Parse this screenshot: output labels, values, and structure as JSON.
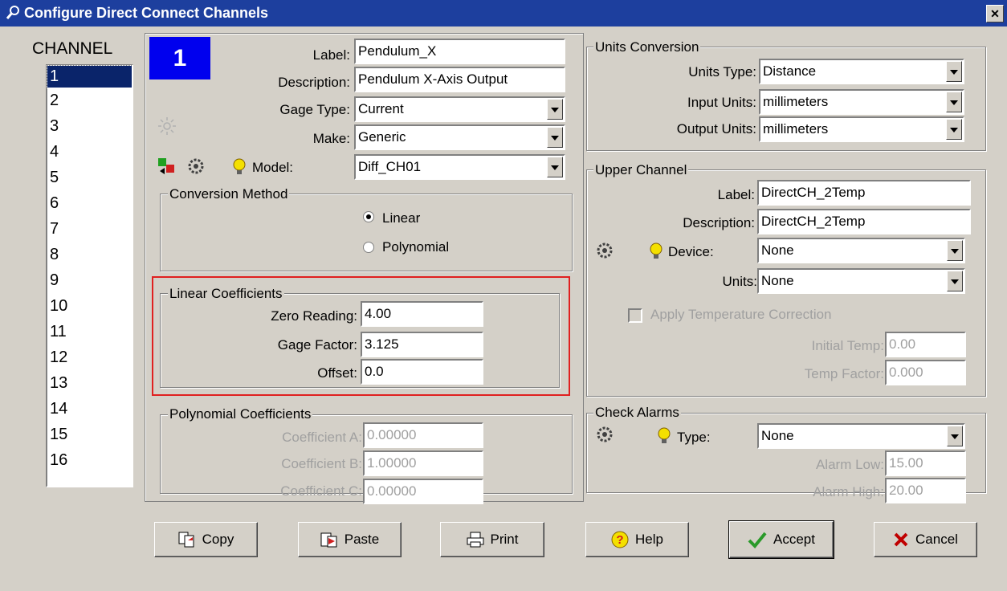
{
  "title": "Configure Direct Connect Channels",
  "channel_header": "CHANNEL",
  "channels": [
    "1",
    "2",
    "3",
    "4",
    "5",
    "6",
    "7",
    "8",
    "9",
    "10",
    "11",
    "12",
    "13",
    "14",
    "15",
    "16"
  ],
  "selected_channel": "1",
  "main": {
    "label_caption": "Label:",
    "label_value": "Pendulum_X",
    "description_caption": "Description:",
    "description_value": "Pendulum X-Axis Output",
    "gage_type_caption": "Gage Type:",
    "gage_type_value": "Current",
    "make_caption": "Make:",
    "make_value": "Generic",
    "model_caption": "Model:",
    "model_value": "Diff_CH01"
  },
  "conversion": {
    "title": "Conversion Method",
    "linear": "Linear",
    "polynomial": "Polynomial",
    "selected": "Linear"
  },
  "linear": {
    "title": "Linear Coefficients",
    "zero_caption": "Zero Reading:",
    "zero_value": "4.00",
    "gage_factor_caption": "Gage Factor:",
    "gage_factor_value": "3.125",
    "offset_caption": "Offset:",
    "offset_value": "0.0"
  },
  "polynomial": {
    "title": "Polynomial Coefficients",
    "a_caption": "Coefficient A:",
    "a_value": "0.00000",
    "b_caption": "Coefficient B:",
    "b_value": "1.00000",
    "c_caption": "Coefficient C:",
    "c_value": "0.00000"
  },
  "units": {
    "title": "Units Conversion",
    "type_caption": "Units Type:",
    "type_value": "Distance",
    "input_caption": "Input Units:",
    "input_value": "millimeters",
    "output_caption": "Output Units:",
    "output_value": "millimeters"
  },
  "upper": {
    "title": "Upper Channel",
    "label_caption": "Label:",
    "label_value": "DirectCH_2Temp",
    "description_caption": "Description:",
    "description_value": "DirectCH_2Temp",
    "device_caption": "Device:",
    "device_value": "None",
    "units_caption": "Units:",
    "units_value": "None",
    "apply_temp": "Apply Temperature Correction",
    "initial_caption": "Initial Temp:",
    "initial_value": "0.00",
    "factor_caption": "Temp Factor:",
    "factor_value": "0.000"
  },
  "alarms": {
    "title": "Check Alarms",
    "type_caption": "Type:",
    "type_value": "None",
    "low_caption": "Alarm Low:",
    "low_value": "15.00",
    "high_caption": "Alarm High:",
    "high_value": "20.00"
  },
  "buttons": {
    "copy": "Copy",
    "paste": "Paste",
    "print": "Print",
    "help": "Help",
    "accept": "Accept",
    "cancel": "Cancel"
  },
  "colors": {
    "titlebar": "#1d3f9e",
    "channel_badge": "#0000ee",
    "highlight_border": "#e02020",
    "bulb": "#f4e000",
    "accept_check": "#2a9a2a",
    "cancel_x": "#c00000"
  }
}
